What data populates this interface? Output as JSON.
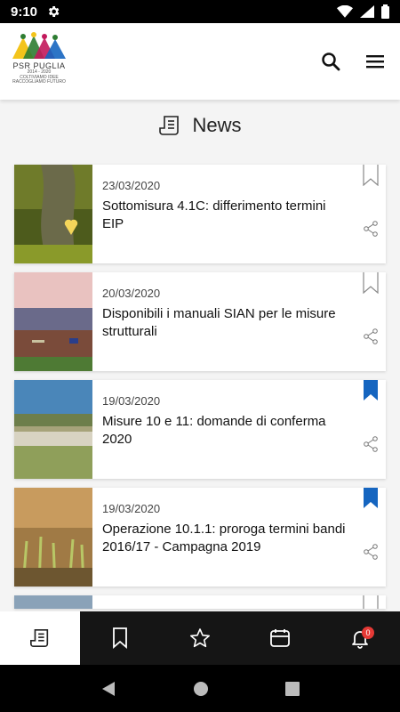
{
  "status_bar": {
    "time": "9:10"
  },
  "header": {
    "logo_text": "PSR PUGLIA",
    "logo_years": "2014 - 2020",
    "logo_tagline_1": "COLTIVIAMO IDEE",
    "logo_tagline_2": "RACCOGLIAMO FUTURO"
  },
  "section": {
    "title": "News"
  },
  "news": [
    {
      "date": "23/03/2020",
      "title": "Sottomisura 4.1C: differimento termini EIP",
      "bookmarked": false
    },
    {
      "date": "20/03/2020",
      "title": "Disponibili i manuali SIAN per le misure strutturali",
      "bookmarked": false
    },
    {
      "date": "19/03/2020",
      "title": "Misure 10 e 11: domande di conferma 2020",
      "bookmarked": true
    },
    {
      "date": "19/03/2020",
      "title": "Operazione 10.1.1: proroga termini bandi 2016/17 - Campagna 2019",
      "bookmarked": true
    }
  ],
  "bottom_nav": {
    "notifications_count": "0"
  },
  "colors": {
    "accent": "#1565c0",
    "nav_bg": "#151515",
    "badge": "#e53935"
  }
}
